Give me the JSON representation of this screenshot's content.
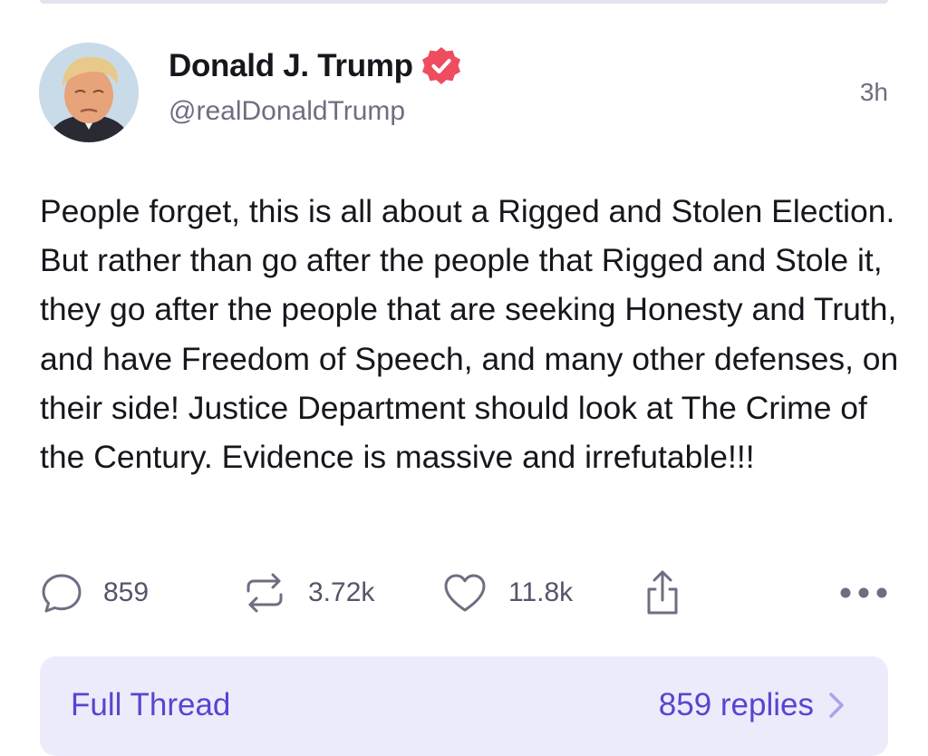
{
  "post": {
    "author": {
      "display_name": "Donald J. Trump",
      "handle": "@realDonaldTrump",
      "verified": true
    },
    "time": "3h",
    "text": "People forget, this is all about a Rigged and Stolen Election. But rather than go after the people that Rigged and Stole it, they go after the people that are seeking Honesty and Truth, and have Freedom of Speech, and many other defenses, on their side! Justice Department should look at The Crime of the Century. Evidence is massive and irrefutable!!!",
    "actions": {
      "replies": "859",
      "reposts": "3.72k",
      "likes": "11.8k"
    }
  },
  "thread": {
    "full_thread_label": "Full Thread",
    "replies_label": "859 replies"
  },
  "icons": {
    "reply": "speech-bubble-icon",
    "repost": "repost-arrows-icon",
    "like": "heart-icon",
    "share": "share-upload-icon",
    "more": "more-dots-icon",
    "verified": "verified-badge-icon",
    "chevron": "chevron-right-icon"
  },
  "colors": {
    "accent": "#5546d0",
    "verified_badge": "#ee4d5f",
    "thread_bg": "#ecebfb",
    "muted_text": "#6e6e82"
  }
}
